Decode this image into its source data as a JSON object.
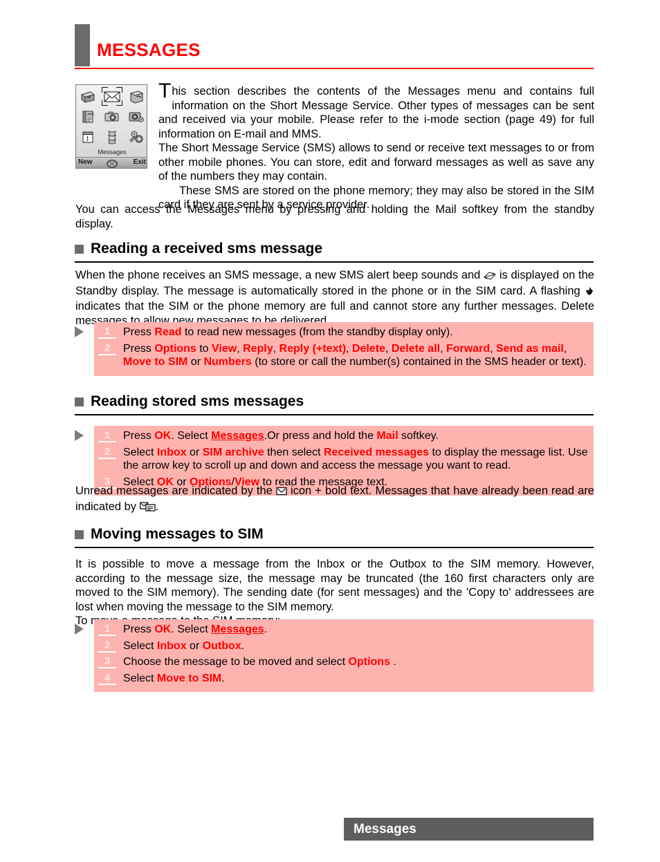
{
  "header": {
    "title": "MESSAGES",
    "accent_color": "#ff0000",
    "block_color": "#6b6b6b"
  },
  "phone_screenshot": {
    "menu_label": "Messages",
    "softkey_left": "New",
    "softkey_right": "Exit",
    "selected_cell_index": 1,
    "icons": [
      "briefcase-icon",
      "envelope-icon",
      "phonebook-icon",
      "abc-book-icon",
      "camera-icon",
      "settings-camera-icon",
      "calendar-icon",
      "notes-icon",
      "tools-icon"
    ]
  },
  "intro": {
    "dropcap": "T",
    "paragraph_1": "his section describes the contents of the Messages menu and contains full information on the Short Message Service. Other types of messages can be sent and received via your mobile. Please refer to the i-mode section (page 49) for full information on E-mail and MMS.",
    "paragraph_2": "The Short Message Service (SMS) allows to send or receive text messages to or from other mobile phones. You can store, edit and forward messages as well as save any of the numbers they may contain.",
    "paragraph_3": "These SMS are stored on the phone memory; they may also be stored in the SIM card if they are sent by a service provider.",
    "paragraph_4": "You can access the Messages menu by pressing and holding the Mail softkey from the standby display."
  },
  "sections": [
    {
      "id": "reading-received",
      "heading": "Reading a received sms message",
      "body_parts": {
        "p1a": "When the phone receives an SMS message, a new SMS alert beep sounds and ",
        "p1b": " is displayed on the Standby display. The message is automatically stored in the phone or in the SIM card. A flashing ",
        "p1c": " indicates that the SIM or the phone memory are full and cannot store any further messages. Delete messages to allow new messages to be delivered."
      },
      "steps": [
        {
          "num": "1",
          "parts": [
            {
              "t": "Press ",
              "s": "plain"
            },
            {
              "t": "Read",
              "s": "key"
            },
            {
              "t": "  to read new messages (from the standby display only).",
              "s": "plain"
            }
          ]
        },
        {
          "num": "2",
          "parts": [
            {
              "t": "Press ",
              "s": "plain"
            },
            {
              "t": "Options",
              "s": "key"
            },
            {
              "t": " to ",
              "s": "plain"
            },
            {
              "t": "View",
              "s": "key"
            },
            {
              "t": ", ",
              "s": "plain"
            },
            {
              "t": "Reply",
              "s": "key"
            },
            {
              "t": ", ",
              "s": "plain"
            },
            {
              "t": "Reply (+text)",
              "s": "key"
            },
            {
              "t": ", ",
              "s": "plain"
            },
            {
              "t": "Delete",
              "s": "key"
            },
            {
              "t": ", ",
              "s": "plain"
            },
            {
              "t": "Delete all",
              "s": "key"
            },
            {
              "t": ", ",
              "s": "plain"
            },
            {
              "t": "Forward",
              "s": "key"
            },
            {
              "t": ", ",
              "s": "plain"
            },
            {
              "t": "Send as mail",
              "s": "key"
            },
            {
              "t": ", ",
              "s": "plain"
            },
            {
              "t": "Move to SIM",
              "s": "key"
            },
            {
              "t": " or ",
              "s": "plain"
            },
            {
              "t": "Numbers",
              "s": "key"
            },
            {
              "t": " (to store or call the number(s) contained in the SMS header or text).",
              "s": "plain"
            }
          ]
        }
      ]
    },
    {
      "id": "reading-stored",
      "heading": "Reading stored sms messages",
      "steps": [
        {
          "num": "1",
          "parts": [
            {
              "t": "Press ",
              "s": "plain"
            },
            {
              "t": "OK",
              "s": "key"
            },
            {
              "t": ". Select ",
              "s": "plain"
            },
            {
              "t": "Messages",
              "s": "key-underline"
            },
            {
              "t": ".Or press and hold the ",
              "s": "plain"
            },
            {
              "t": "Mail",
              "s": "key"
            },
            {
              "t": " softkey.",
              "s": "plain"
            }
          ]
        },
        {
          "num": "2",
          "parts": [
            {
              "t": "Select ",
              "s": "plain"
            },
            {
              "t": "Inbox",
              "s": "key"
            },
            {
              "t": " or ",
              "s": "plain"
            },
            {
              "t": "SIM archive",
              "s": "key"
            },
            {
              "t": " then select ",
              "s": "plain"
            },
            {
              "t": "Received messages",
              "s": "key"
            },
            {
              "t": " to display the message list. Use the arrow key to scroll up and down and access the message you want to read.",
              "s": "plain"
            }
          ]
        },
        {
          "num": "3",
          "parts": [
            {
              "t": "Select ",
              "s": "plain"
            },
            {
              "t": "OK",
              "s": "key"
            },
            {
              "t": " or ",
              "s": "plain"
            },
            {
              "t": "Options",
              "s": "key"
            },
            {
              "t": "/",
              "s": "plain"
            },
            {
              "t": "View",
              "s": "key"
            },
            {
              "t": "  to read the message text.",
              "s": "plain"
            }
          ]
        }
      ],
      "after_note": {
        "a": "Unread messages are indicated by the ",
        "b": " icon + bold text. Messages that have already been read are indicated by ",
        "c": "."
      }
    },
    {
      "id": "moving-to-sim",
      "heading": "Moving messages to SIM",
      "body_parts": {
        "p1": "It is possible to move a message from the Inbox or the Outbox to the SIM memory. However, according to the message size, the message may be truncated (the 160 first characters only are moved to the SIM memory). The sending date (for sent messages) and the 'Copy to' addressees are lost when moving the message to the SIM memory.",
        "p2": "To move a message to the SIM memory:"
      },
      "steps": [
        {
          "num": "1",
          "parts": [
            {
              "t": "Press ",
              "s": "plain"
            },
            {
              "t": "OK",
              "s": "key"
            },
            {
              "t": ". Select ",
              "s": "plain"
            },
            {
              "t": "Messages",
              "s": "key-underline"
            },
            {
              "t": ".",
              "s": "plain"
            }
          ]
        },
        {
          "num": "2",
          "parts": [
            {
              "t": "Select ",
              "s": "plain"
            },
            {
              "t": "Inbox",
              "s": "key"
            },
            {
              "t": " or ",
              "s": "plain"
            },
            {
              "t": "Outbox",
              "s": "key"
            },
            {
              "t": ".",
              "s": "plain"
            }
          ]
        },
        {
          "num": "3",
          "parts": [
            {
              "t": "Choose the message to be moved and select ",
              "s": "plain"
            },
            {
              "t": "Options",
              "s": "key"
            },
            {
              "t": " .",
              "s": "plain"
            }
          ]
        },
        {
          "num": "4",
          "parts": [
            {
              "t": "Select ",
              "s": "plain"
            },
            {
              "t": "Move to SIM",
              "s": "key"
            },
            {
              "t": ".",
              "s": "plain"
            }
          ]
        }
      ]
    }
  ],
  "footer": {
    "label": "Messages",
    "bar_color": "#5e5e5e"
  },
  "colors": {
    "step_box_bg": "#ffb3ae",
    "keyword_red": "#ff0000",
    "gray_block": "#6b6b6b",
    "footer_gray": "#5e5e5e"
  }
}
